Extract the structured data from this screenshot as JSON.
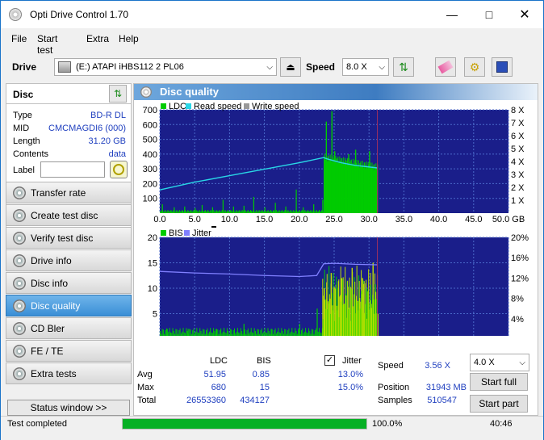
{
  "window": {
    "title": "Opti Drive Control 1.70"
  },
  "menu": [
    "File",
    "Start test",
    "Extra",
    "Help"
  ],
  "drivebar": {
    "drive_label": "Drive",
    "drive_value": "(E:)  ATAPI iHBS112  2 PL06",
    "speed_label": "Speed",
    "speed_value": "8.0 X"
  },
  "disc": {
    "header": "Disc",
    "rows": [
      {
        "k": "Type",
        "v": "BD-R DL"
      },
      {
        "k": "MID",
        "v": "CMCMAGDI6 (000)"
      },
      {
        "k": "Length",
        "v": "31.20 GB"
      },
      {
        "k": "Contents",
        "v": "data"
      }
    ],
    "label_key": "Label",
    "label_value": ""
  },
  "nav": [
    {
      "label": "Transfer rate",
      "active": false
    },
    {
      "label": "Create test disc",
      "active": false
    },
    {
      "label": "Verify test disc",
      "active": false
    },
    {
      "label": "Drive info",
      "active": false
    },
    {
      "label": "Disc info",
      "active": false
    },
    {
      "label": "Disc quality",
      "active": true
    },
    {
      "label": "CD Bler",
      "active": false
    },
    {
      "label": "FE / TE",
      "active": false
    },
    {
      "label": "Extra tests",
      "active": false
    }
  ],
  "status_window": "Status window >>",
  "panel_title": "Disc quality",
  "chart_data": [
    {
      "type": "bar",
      "legend": [
        "LDC",
        "Read speed",
        "Write speed"
      ],
      "x_ticks": [
        "0.0",
        "5.0",
        "10.0",
        "15.0",
        "20.0",
        "25.0",
        "30.0",
        "35.0",
        "40.0",
        "45.0",
        "50.0 GB"
      ],
      "xlim": [
        0,
        50
      ],
      "y_ticks": [
        "100",
        "200",
        "300",
        "400",
        "500",
        "600",
        "700"
      ],
      "ylim": [
        0,
        700
      ],
      "y2_ticks": [
        "1 X",
        "2 X",
        "3 X",
        "4 X",
        "5 X",
        "6 X",
        "7 X",
        "8 X"
      ],
      "y2lim": [
        0,
        8
      ],
      "ldc_peaks": [
        [
          0.3,
          60
        ],
        [
          2,
          40
        ],
        [
          3.5,
          45
        ],
        [
          5,
          35
        ],
        [
          6,
          55
        ],
        [
          7.5,
          40
        ],
        [
          9,
          90
        ],
        [
          10.5,
          45
        ],
        [
          12,
          50
        ],
        [
          13.4,
          110
        ],
        [
          15,
          40
        ],
        [
          16.5,
          70
        ],
        [
          18,
          45
        ],
        [
          19.5,
          160
        ],
        [
          20.5,
          40
        ],
        [
          22,
          60
        ],
        [
          23.3,
          90
        ],
        [
          23.8,
          620
        ],
        [
          24.2,
          300
        ],
        [
          24.6,
          690
        ],
        [
          25,
          420
        ],
        [
          27,
          400
        ],
        [
          28,
          430
        ],
        [
          30,
          420
        ],
        [
          31,
          300
        ]
      ],
      "read_speed": [
        [
          0,
          1.8
        ],
        [
          5,
          2.4
        ],
        [
          10,
          2.9
        ],
        [
          15,
          3.4
        ],
        [
          20,
          3.9
        ],
        [
          23.5,
          4.3
        ],
        [
          24,
          4.2
        ],
        [
          26,
          3.9
        ],
        [
          28,
          3.7
        ],
        [
          31.2,
          3.5
        ]
      ]
    },
    {
      "type": "bar",
      "legend": [
        "BIS",
        "Jitter"
      ],
      "x_ticks": [
        "0.0",
        "5.0",
        "10.0",
        "15.0",
        "20.0",
        "25.0",
        "30.0",
        "35.0",
        "40.0",
        "45.0",
        "50.0 GB"
      ],
      "xlim": [
        0,
        50
      ],
      "y_ticks": [
        "5",
        "10",
        "15",
        "20"
      ],
      "ylim": [
        0,
        20
      ],
      "y2_ticks": [
        "4%",
        "8%",
        "12%",
        "16%",
        "20%"
      ],
      "y2lim": [
        0,
        20
      ],
      "bis_peaks": [
        [
          1,
          2
        ],
        [
          4,
          2
        ],
        [
          8,
          2
        ],
        [
          12,
          3
        ],
        [
          16,
          2
        ],
        [
          20,
          3
        ],
        [
          22.5,
          6
        ],
        [
          23.5,
          10
        ],
        [
          24.5,
          13
        ],
        [
          26,
          12
        ],
        [
          27.5,
          14
        ],
        [
          29,
          12
        ],
        [
          30.5,
          15
        ],
        [
          31.2,
          5
        ]
      ],
      "jitter": [
        [
          0,
          13.3
        ],
        [
          5,
          13
        ],
        [
          10,
          12.8
        ],
        [
          15,
          12.5
        ],
        [
          20,
          12.3
        ],
        [
          22.5,
          12.5
        ],
        [
          23.5,
          14.8
        ],
        [
          25,
          14.9
        ],
        [
          28,
          14.7
        ],
        [
          31.2,
          14.6
        ]
      ]
    }
  ],
  "stats": {
    "col_ldc": "LDC",
    "col_bis": "BIS",
    "jitter_label": "Jitter",
    "jitter_checked": true,
    "rows": [
      {
        "k": "Avg",
        "ldc": "51.95",
        "bis": "0.85",
        "jit": "13.0%"
      },
      {
        "k": "Max",
        "ldc": "680",
        "bis": "15",
        "jit": "15.0%"
      },
      {
        "k": "Total",
        "ldc": "26553360",
        "bis": "434127",
        "jit": ""
      }
    ],
    "speed_label": "Speed",
    "speed_value": "3.56 X",
    "position_label": "Position",
    "position_value": "31943 MB",
    "samples_label": "Samples",
    "samples_value": "510547",
    "speed_select": "4.0 X",
    "start_full": "Start full",
    "start_part": "Start part"
  },
  "statusbar": {
    "text": "Test completed",
    "progress_pct": 100,
    "progress_label": "100.0%",
    "time": "40:46"
  },
  "colors": {
    "ldc": "#00cc00",
    "read": "#29d6e6",
    "bis": "#00cc00",
    "bis_hi": "#bfe000",
    "jitter": "#8080ff",
    "plotbg": "#1a1e8a",
    "grid": "#4a6aca"
  }
}
